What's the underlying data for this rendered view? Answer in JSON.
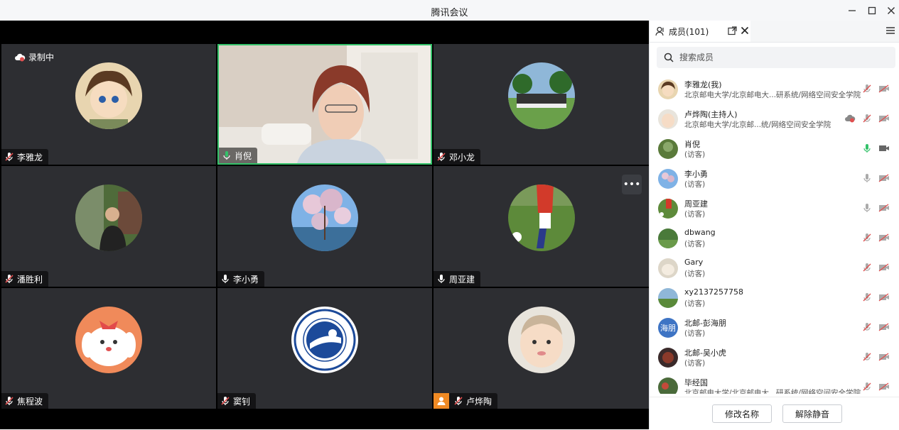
{
  "window": {
    "title": "腾讯会议"
  },
  "recording": {
    "label": "录制中"
  },
  "tiles": [
    {
      "name": "李雅龙",
      "mic": "muted"
    },
    {
      "name": "肖倪",
      "mic": "active"
    },
    {
      "name": "邓小龙",
      "mic": "muted"
    },
    {
      "name": "潘胜利",
      "mic": "muted"
    },
    {
      "name": "李小勇",
      "mic": "on"
    },
    {
      "name": "周亚建",
      "mic": "on"
    },
    {
      "name": "焦程波",
      "mic": "muted"
    },
    {
      "name": "窦钊",
      "mic": "muted"
    },
    {
      "name": "卢烨陶",
      "mic": "muted"
    }
  ],
  "panel": {
    "tab_label": "成员(101)",
    "search_placeholder": "搜索成员",
    "members": [
      {
        "name": "李雅龙(我)",
        "sub": "北京邮电大学/北京邮电大...研系统/网络空间安全学院",
        "mic": "muted",
        "recording": false
      },
      {
        "name": "卢烨陶(主持人)",
        "sub": "北京邮电大学/北京邮...统/网络空间安全学院",
        "mic": "muted",
        "recording": true
      },
      {
        "name": "肖倪",
        "sub": "(访客)",
        "mic": "active",
        "recording": false
      },
      {
        "name": "李小勇",
        "sub": "(访客)",
        "mic": "on",
        "recording": false
      },
      {
        "name": "周亚建",
        "sub": "(访客)",
        "mic": "on",
        "recording": false
      },
      {
        "name": "dbwang",
        "sub": "(访客)",
        "mic": "muted",
        "recording": false
      },
      {
        "name": "Gary",
        "sub": "(访客)",
        "mic": "muted",
        "recording": false
      },
      {
        "name": "xy2137257758",
        "sub": "(访客)",
        "mic": "muted",
        "recording": false
      },
      {
        "name": "北邮-彭海朋",
        "sub": "(访客)",
        "mic": "muted",
        "recording": false,
        "avatar_text": "海朋"
      },
      {
        "name": "北邮-吴小虎",
        "sub": "(访客)",
        "mic": "muted",
        "recording": false
      },
      {
        "name": "毕经国",
        "sub": "北京邮电大学/北京邮电大...研系统/网络空间安全学院",
        "mic": "muted",
        "recording": false
      }
    ]
  },
  "footer": {
    "rename_label": "修改名称",
    "unmute_label": "解除静音"
  },
  "colors": {
    "active_border": "#34c26a",
    "host_badge": "#f08a24",
    "muted_red": "#e05050",
    "mic_green": "#34c26a"
  }
}
